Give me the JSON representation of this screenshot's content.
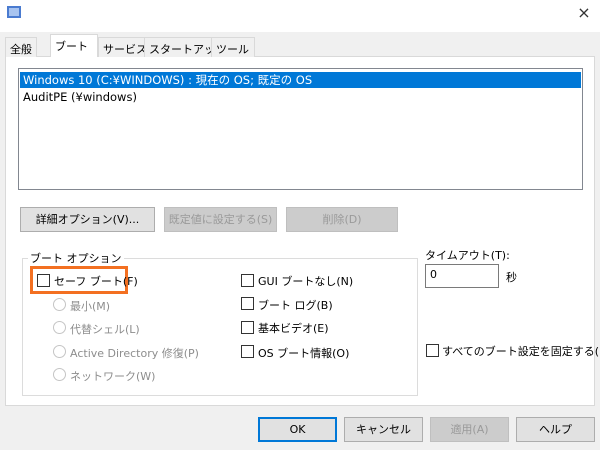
{
  "window": {
    "close_icon": "×"
  },
  "tabs": [
    {
      "label": "全般"
    },
    {
      "label": "ブート"
    },
    {
      "label": "サービス"
    },
    {
      "label": "スタートアップ"
    },
    {
      "label": "ツール"
    }
  ],
  "boot_list": [
    {
      "label": "Windows 10 (C:¥WINDOWS) : 現在の OS; 既定の OS",
      "selected": true
    },
    {
      "label": "AuditPE (¥windows)",
      "selected": false
    }
  ],
  "list_buttons": {
    "advanced": "詳細オプション(V)...",
    "set_default": "既定値に設定する(S)",
    "delete": "削除(D)"
  },
  "boot_options": {
    "title": "ブート オプション",
    "safe_boot": {
      "label": "セーフ ブート(F)",
      "checked": false
    },
    "radios": [
      {
        "label": "最小(M)"
      },
      {
        "label": "代替シェル(L)"
      },
      {
        "label": "Active Directory 修復(P)"
      },
      {
        "label": "ネットワーク(W)"
      }
    ],
    "checks": [
      {
        "label": "GUI ブートなし(N)",
        "checked": false
      },
      {
        "label": "ブート ログ(B)",
        "checked": false
      },
      {
        "label": "基本ビデオ(E)",
        "checked": false
      },
      {
        "label": "OS ブート情報(O)",
        "checked": false
      }
    ]
  },
  "timeout": {
    "label": "タイムアウト(T):",
    "value": "0",
    "unit": "秒"
  },
  "make_permanent": {
    "label": "すべてのブート設定を固定する(K)",
    "checked": false
  },
  "footer": {
    "ok": "OK",
    "cancel": "キャンセル",
    "apply": "適用(A)",
    "help": "ヘルプ"
  },
  "colors": {
    "selection": "#0078d7",
    "highlight": "#f37021"
  }
}
